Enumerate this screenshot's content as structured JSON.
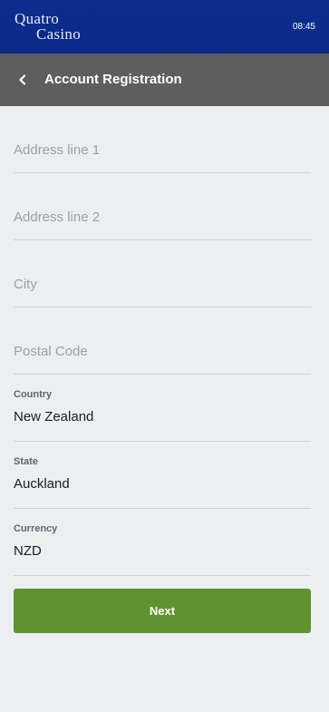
{
  "header": {
    "logo_line1": "Quatro",
    "logo_line2": "Casino",
    "time": "08:45"
  },
  "titlebar": {
    "back_icon": "chevron-left-icon",
    "title": "Account Registration"
  },
  "form": {
    "address1": {
      "placeholder": "Address line 1",
      "value": ""
    },
    "address2": {
      "placeholder": "Address line 2",
      "value": ""
    },
    "city": {
      "placeholder": "City",
      "value": ""
    },
    "postal": {
      "placeholder": "Postal Code",
      "value": ""
    },
    "country": {
      "label": "Country",
      "value": "New Zealand"
    },
    "state": {
      "label": "State",
      "value": "Auckland"
    },
    "currency": {
      "label": "Currency",
      "value": "NZD"
    }
  },
  "actions": {
    "next_label": "Next",
    "next_color": "#5f9330"
  },
  "colors": {
    "header_bg": "#0e2c8e",
    "titlebar_bg": "#5e5e5e",
    "page_bg": "#ebeff0"
  }
}
